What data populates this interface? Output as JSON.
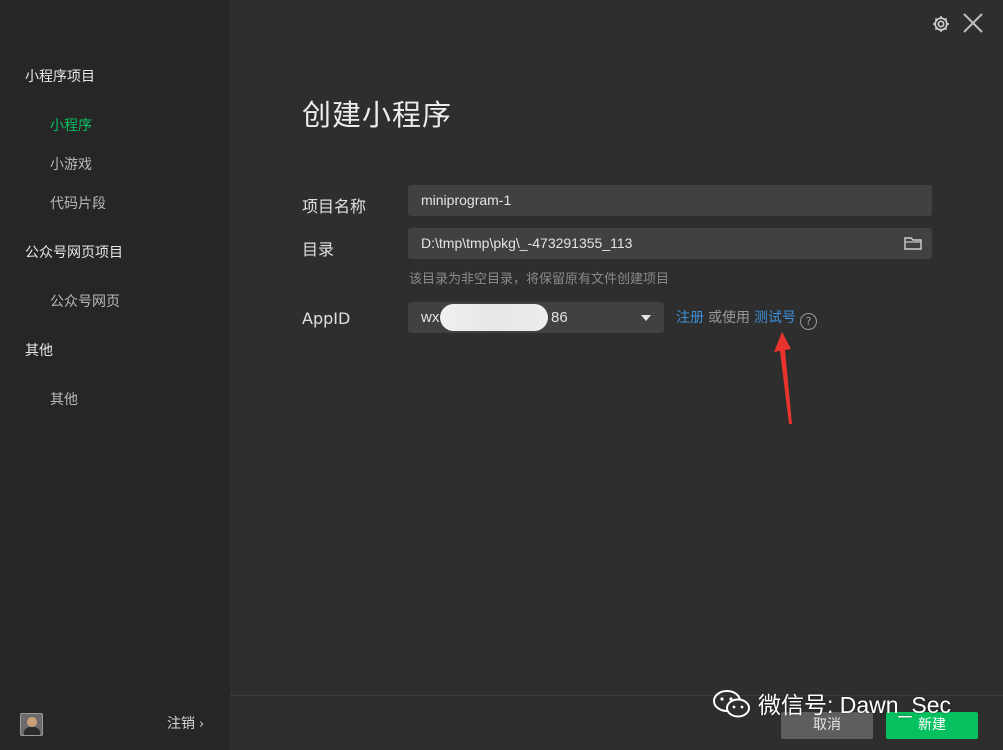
{
  "sidebar": {
    "sections": [
      {
        "label": "小程序项目",
        "items": [
          {
            "label": "小程序",
            "active": true
          },
          {
            "label": "小游戏"
          },
          {
            "label": "代码片段"
          }
        ]
      },
      {
        "label": "公众号网页项目",
        "items": [
          {
            "label": "公众号网页"
          }
        ]
      },
      {
        "label": "其他",
        "items": [
          {
            "label": "其他"
          }
        ]
      }
    ],
    "footer": {
      "logout_label": "注销",
      "logout_chevron": "›"
    }
  },
  "top_icons": {
    "settings": "gear-icon",
    "close": "close-icon"
  },
  "main": {
    "title": "创建小程序",
    "fields": {
      "project_name": {
        "label": "项目名称",
        "value": "miniprogram-1"
      },
      "directory": {
        "label": "目录",
        "value": "D:\\tmp\\tmp\\pkg\\_-473291355_113",
        "hint": "该目录为非空目录，将保留原有文件创建项目"
      },
      "appid": {
        "label": "AppID",
        "value_start": "wx",
        "value_end": "86",
        "register_link": "注册",
        "or_text": "或使用",
        "test_link": "测试号",
        "help_icon_text": "?"
      }
    }
  },
  "footer": {
    "cancel_label": "取消",
    "create_label": "新建"
  },
  "watermark": {
    "text": "微信号: Dawn_Sec"
  },
  "colors": {
    "accent": "#07c160",
    "link": "#3e8ed8",
    "annotation": "#e8342c"
  }
}
